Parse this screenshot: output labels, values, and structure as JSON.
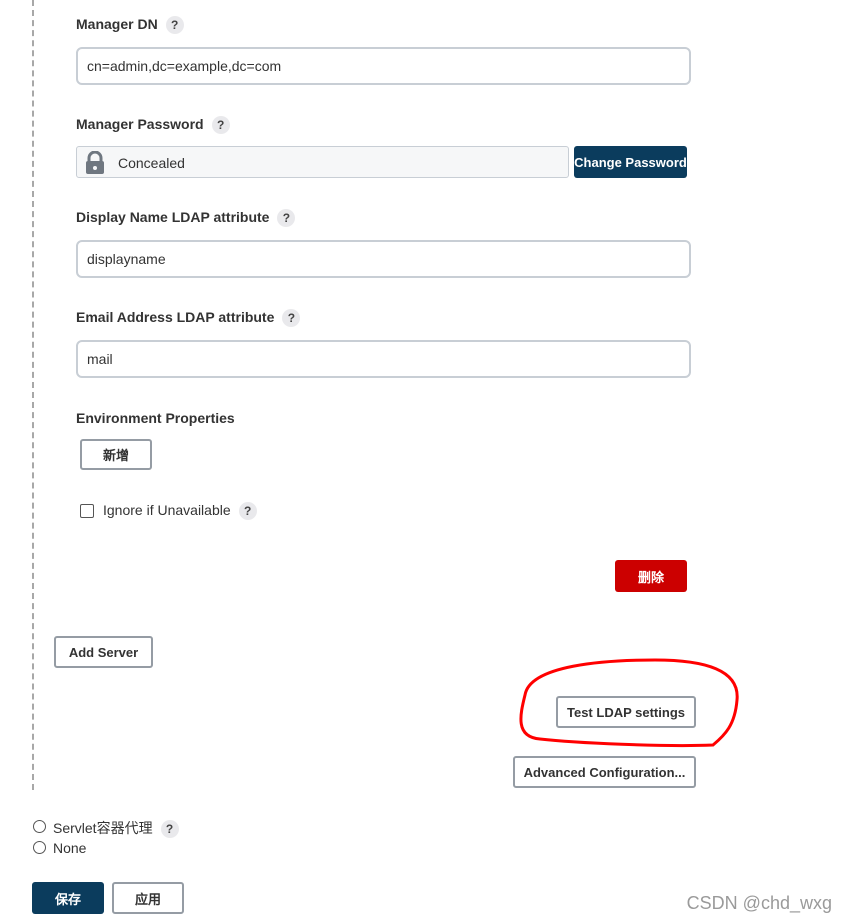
{
  "fields": {
    "manager_dn": {
      "label": "Manager DN",
      "help": "?",
      "value": "cn=admin,dc=example,dc=com"
    },
    "manager_password": {
      "label": "Manager Password",
      "help": "?",
      "state": "Concealed",
      "change_button": "Change Password"
    },
    "display_name_attr": {
      "label": "Display Name LDAP attribute",
      "help": "?",
      "value": "displayname"
    },
    "email_attr": {
      "label": "Email Address LDAP attribute",
      "help": "?",
      "value": "mail"
    }
  },
  "environment": {
    "label": "Environment Properties",
    "add_button": "新增"
  },
  "ignore_if_unavailable": {
    "label": "Ignore if Unavailable",
    "help": "?",
    "checked": false
  },
  "delete_button": "删除",
  "add_server_button": "Add Server",
  "test_ldap_button": "Test LDAP settings",
  "advanced_config_button": "Advanced Configuration...",
  "security_realm_options": [
    {
      "label": "Servlet容器代理",
      "help": "?",
      "selected": false
    },
    {
      "label": "None",
      "selected": false
    }
  ],
  "footer": {
    "save_button": "保存",
    "apply_button": "应用"
  },
  "watermark": "CSDN @chd_wxg",
  "colors": {
    "primary": "#0b3c5d",
    "danger": "#cc0000",
    "annotation": "#ff0000"
  }
}
